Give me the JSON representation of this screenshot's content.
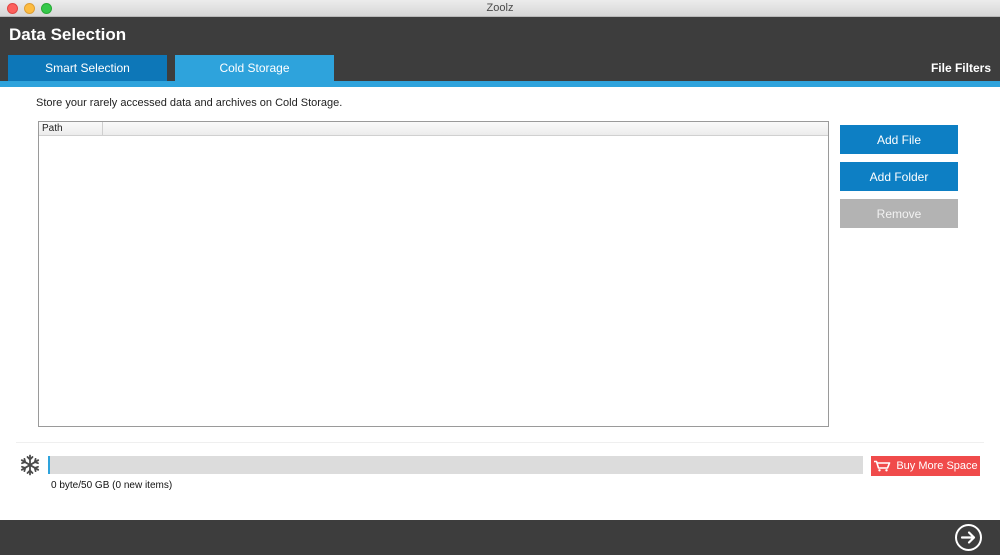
{
  "window": {
    "title": "Zoolz"
  },
  "header": {
    "title": "Data Selection",
    "tabs": [
      {
        "label": "Smart Selection",
        "active": false
      },
      {
        "label": "Cold Storage",
        "active": true
      }
    ],
    "file_filters_label": "File Filters"
  },
  "main": {
    "description": "Store your rarely accessed data and archives on Cold Storage.",
    "table": {
      "columns": [
        "Path"
      ],
      "rows": []
    },
    "buttons": {
      "add_file": "Add File",
      "add_folder": "Add Folder",
      "remove": "Remove"
    }
  },
  "storage": {
    "icon": "snowflake-icon",
    "used_fraction": 0,
    "buy_label": "Buy More Space",
    "usage_text": "0 byte/50 GB (0 new items)"
  },
  "footer": {
    "next_icon": "arrow-right-circle-icon"
  },
  "colors": {
    "header_bg": "#3d3d3d",
    "accent_blue": "#2ea3dc",
    "button_blue": "#0d7fc4",
    "disabled_gray": "#b3b3b3",
    "buy_red": "#f04b4b"
  }
}
